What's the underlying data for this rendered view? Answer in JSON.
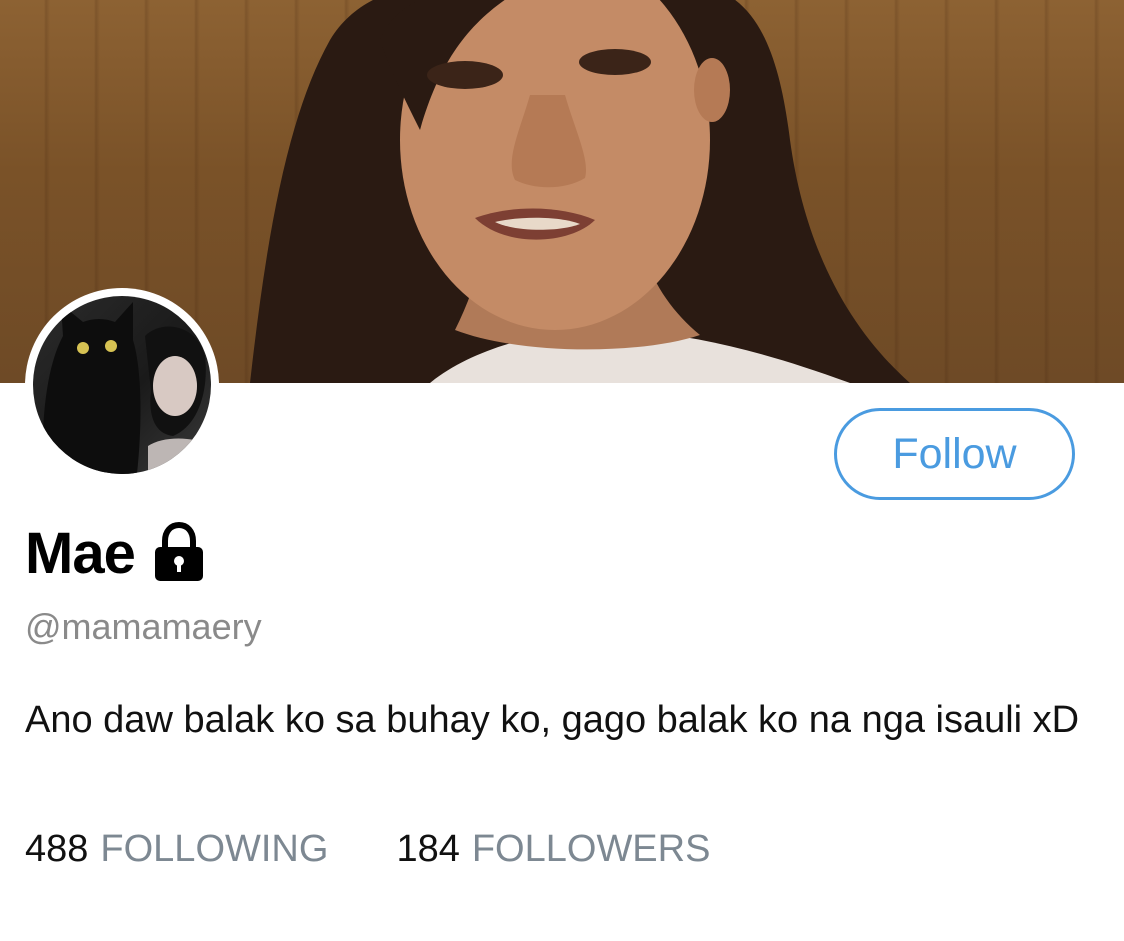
{
  "profile": {
    "display_name": "Mae",
    "handle": "@mamamaery",
    "protected_icon": "lock-icon",
    "bio": "Ano daw balak ko sa buhay ko, gago balak ko na nga isauli xD",
    "follow_label": "Follow"
  },
  "stats": {
    "following_count": "488",
    "following_label": "FOLLOWING",
    "followers_count": "184",
    "followers_label": "FOLLOWERS"
  },
  "colors": {
    "accent": "#4a9be0",
    "muted": "#7d8892",
    "text": "#111111"
  }
}
